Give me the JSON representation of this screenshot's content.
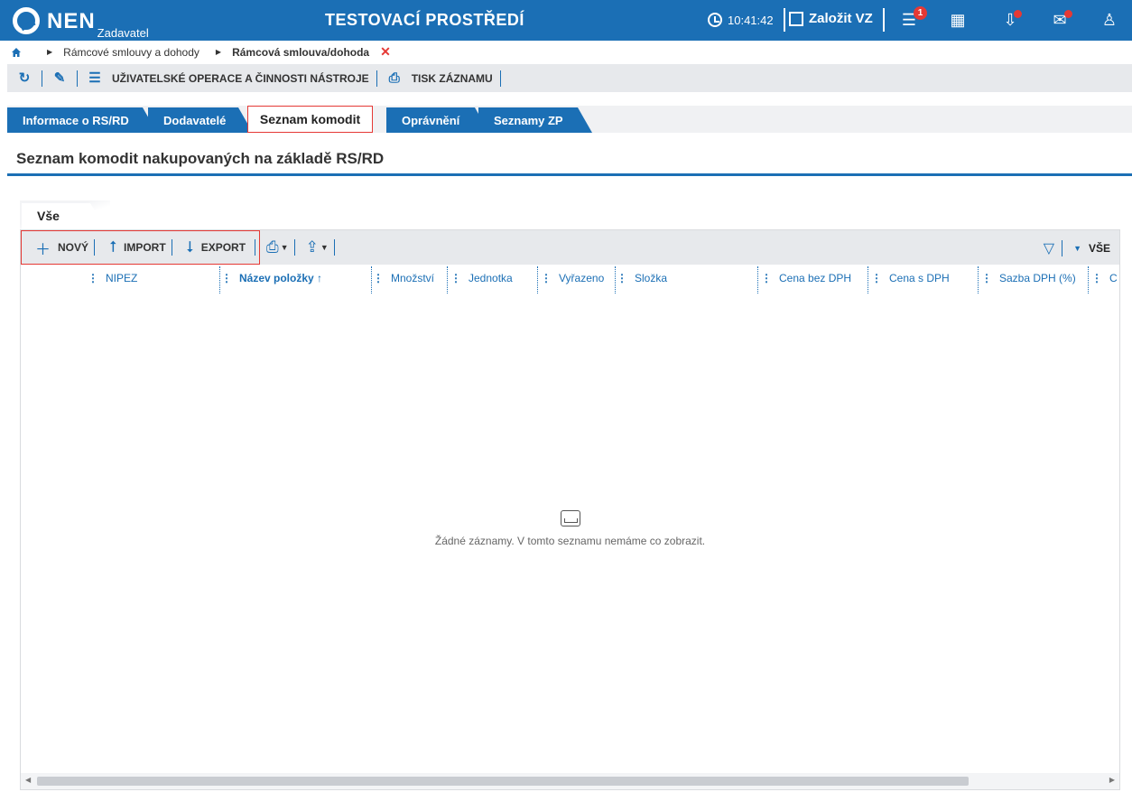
{
  "topbar": {
    "logo": "NEN",
    "logo_sub": "Zadavatel",
    "env_title": "TESTOVACÍ PROSTŘEDÍ",
    "time": "10:41:42",
    "create_label": "Založit VZ",
    "menu_badge": "1"
  },
  "breadcrumb": {
    "item1": "Rámcové smlouvy a dohody",
    "current": "Rámcová smlouva/dohoda"
  },
  "actionbar": {
    "user_ops": "UŽIVATELSKÉ OPERACE A ČINNOSTI NÁSTROJE",
    "print": "TISK ZÁZNAMU"
  },
  "tabs": {
    "tab1": "Informace o RS/RD",
    "tab2": "Dodavatelé",
    "tab3": "Seznam komodit",
    "tab4": "Oprávnění",
    "tab5": "Seznamy ZP"
  },
  "section": {
    "title": "Seznam komodit nakupovaných na základě RS/RD"
  },
  "subtab": {
    "label": "Vše"
  },
  "grid_toolbar": {
    "new": "NOVÝ",
    "import": "IMPORT",
    "export": "EXPORT",
    "filter_all": "VŠE"
  },
  "columns": {
    "c1": "NIPEZ",
    "c2": "Název položky ↑",
    "c3": "Množství",
    "c4": "Jednotka",
    "c5": "Vyřazeno",
    "c6": "Složka",
    "c7": "Cena bez DPH",
    "c8": "Cena s DPH",
    "c9": "Sazba DPH (%)",
    "c10": "C"
  },
  "empty": {
    "message": "Žádné záznamy. V tomto seznamu nemáme co zobrazit."
  }
}
